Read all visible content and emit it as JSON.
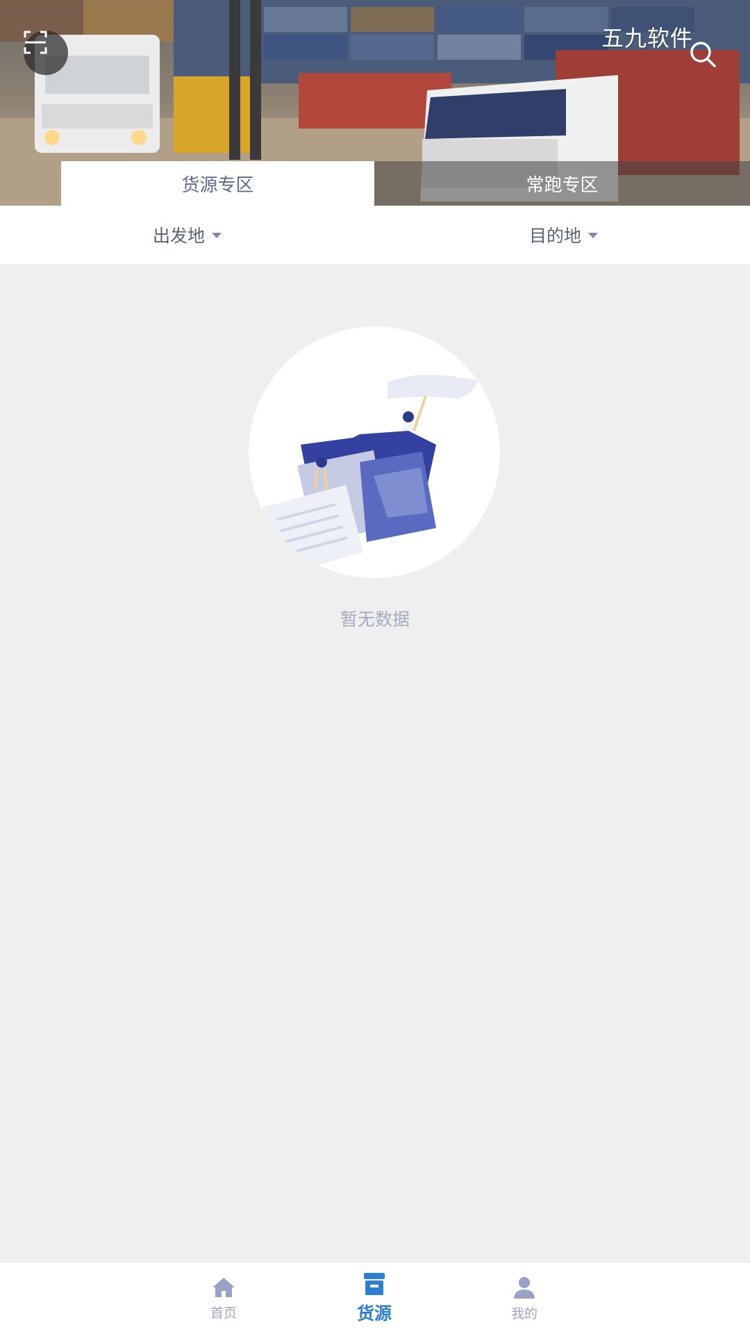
{
  "header": {
    "watermark": "五九软件",
    "scan_icon": "scan-icon",
    "search_icon": "search-icon"
  },
  "tabs": [
    {
      "label": "货源专区",
      "active": true
    },
    {
      "label": "常跑专区",
      "active": false
    }
  ],
  "filters": {
    "origin_label": "出发地",
    "destination_label": "目的地"
  },
  "empty_state": {
    "text": "暂无数据",
    "illustration": "empty-folder-illustration"
  },
  "bottom_nav": {
    "items": [
      {
        "label": "首页",
        "icon": "home-icon",
        "active": false
      },
      {
        "label": "货源",
        "icon": "cargo-box-icon",
        "active": true
      },
      {
        "label": "我的",
        "icon": "profile-icon",
        "active": false
      }
    ]
  },
  "colors": {
    "active_nav": "#2f7fd0",
    "inactive_nav": "#a0a6bf",
    "page_bg": "#efefef",
    "illustration_accent": "#3b4aa6"
  }
}
